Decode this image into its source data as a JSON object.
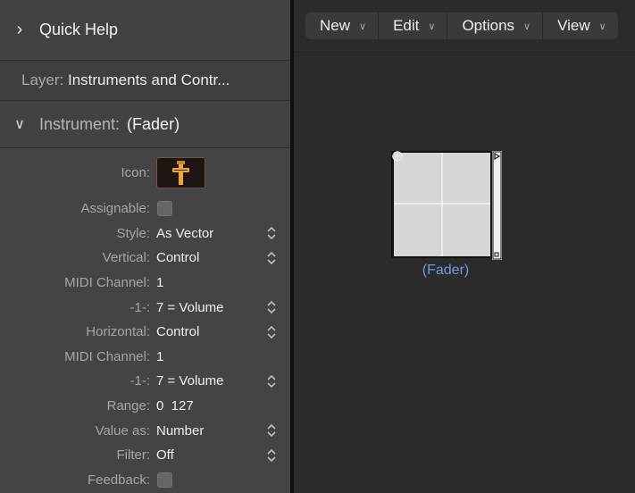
{
  "inspector": {
    "quick_help": {
      "label": "Quick Help",
      "chevron": "chevron-right-icon"
    },
    "layer": {
      "key": "Layer:",
      "value": "Instruments and Contr..."
    },
    "instrument": {
      "chevron": "chevron-down-icon",
      "key": "Instrument:",
      "value": "(Fader)"
    },
    "properties": {
      "icon_label": "Icon:",
      "assignable_label": "Assignable:",
      "style_label": "Style:",
      "style_value": "As Vector",
      "vertical_label": "Vertical:",
      "vertical_value": "Control",
      "midi_channel_1_label": "MIDI Channel:",
      "midi_channel_1_value": "1",
      "cc_1_label": "-1-:",
      "cc_1_value": "7 = Volume",
      "horizontal_label": "Horizontal:",
      "horizontal_value": "Control",
      "midi_channel_2_label": "MIDI Channel:",
      "midi_channel_2_value": "1",
      "cc_2_label": "-1-:",
      "cc_2_value": "7 = Volume",
      "range_label": "Range:",
      "range_value": "0  127",
      "value_as_label": "Value as:",
      "value_as_value": "Number",
      "filter_label": "Filter:",
      "filter_value": "Off",
      "feedback_label": "Feedback:"
    }
  },
  "toolbar": {
    "menus": [
      "New",
      "Edit",
      "Options",
      "View"
    ]
  },
  "canvas": {
    "object_label": "(Fader)"
  },
  "colors": {
    "label_link": "#6e9ae0",
    "icon_accent": "#f0a632"
  }
}
